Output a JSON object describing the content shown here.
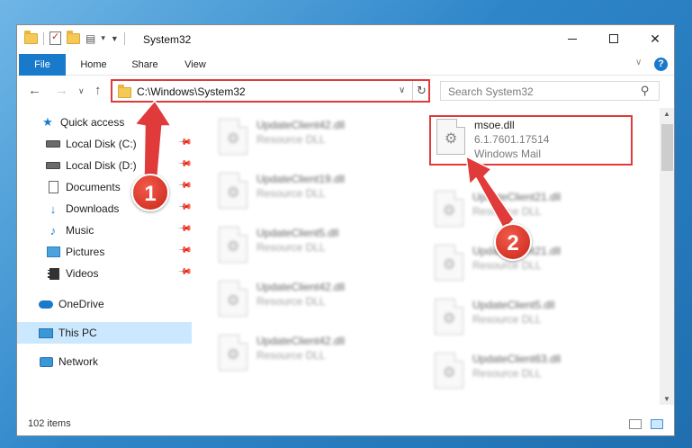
{
  "window": {
    "title": "System32"
  },
  "ribbon": {
    "tabs": [
      "File",
      "Home",
      "Share",
      "View"
    ]
  },
  "navbar": {
    "address": "C:\\Windows\\System32",
    "search_placeholder": "Search System32"
  },
  "sidebar": {
    "items": [
      {
        "label": "Quick access",
        "icon": "star-icon",
        "pinned": false
      },
      {
        "label": "Local Disk (C:)",
        "icon": "disk-icon",
        "pinned": true
      },
      {
        "label": "Local Disk (D:)",
        "icon": "disk-icon",
        "pinned": true
      },
      {
        "label": "Documents",
        "icon": "documents-icon",
        "pinned": true
      },
      {
        "label": "Downloads",
        "icon": "download-icon",
        "pinned": true
      },
      {
        "label": "Music",
        "icon": "music-icon",
        "pinned": true
      },
      {
        "label": "Pictures",
        "icon": "pictures-icon",
        "pinned": true
      },
      {
        "label": "Videos",
        "icon": "videos-icon",
        "pinned": true
      },
      {
        "label": "OneDrive",
        "icon": "onedrive-icon",
        "pinned": false
      },
      {
        "label": "This PC",
        "icon": "this-pc-icon",
        "pinned": false,
        "selected": true
      },
      {
        "label": "Network",
        "icon": "network-icon",
        "pinned": false
      }
    ]
  },
  "files": {
    "highlighted": {
      "name": "msoe.dll",
      "version": "6.1.7601.17514",
      "description": "Windows Mail"
    },
    "left_column": [
      {
        "name": "UpdateClient42.dll",
        "type": "Resource DLL"
      },
      {
        "name": "UpdateClient19.dll",
        "type": "Resource DLL"
      },
      {
        "name": "UpdateClient5.dll",
        "type": "Resource DLL"
      },
      {
        "name": "UpdateClient42.dll",
        "type": "Resource DLL"
      },
      {
        "name": "UpdateClient42.dll",
        "type": "Resource DLL"
      }
    ],
    "right_column": [
      {
        "name": "UpdateClient21.dll",
        "type": "Resource DLL"
      },
      {
        "name": "UpdateClient21.dll",
        "type": "Resource DLL"
      },
      {
        "name": "UpdateClient5.dll",
        "type": "Resource DLL"
      },
      {
        "name": "UpdateClient63.dll",
        "type": "Resource DLL"
      }
    ]
  },
  "status": {
    "item_count": "102 items"
  },
  "annotations": {
    "step1": "1",
    "step2": "2",
    "color": "#e03a3a"
  }
}
